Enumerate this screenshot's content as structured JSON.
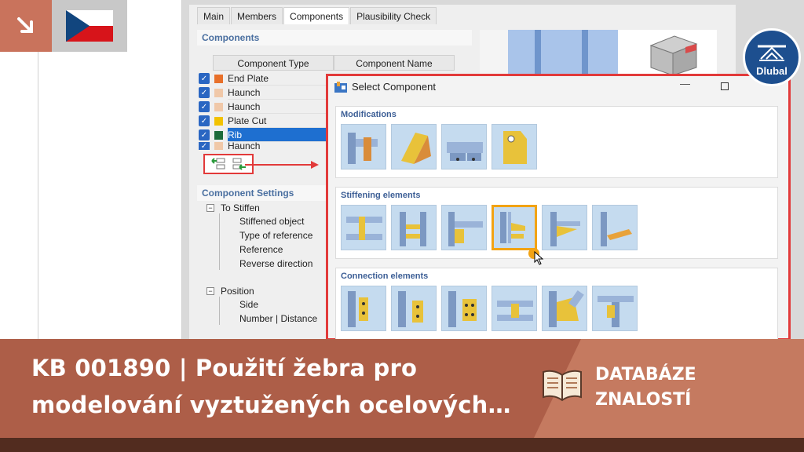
{
  "tabs": [
    "Main",
    "Members",
    "Components",
    "Plausibility Check"
  ],
  "components_section": {
    "title": "Components",
    "col_type": "Component Type",
    "col_name": "Component Name",
    "rows": [
      {
        "label": "End Plate",
        "color": "#e8702a"
      },
      {
        "label": "Haunch",
        "color": "#f0c8a8"
      },
      {
        "label": "Haunch",
        "color": "#f0c8a8"
      },
      {
        "label": "Plate Cut",
        "color": "#f2c200"
      },
      {
        "label": "Rib",
        "color": "#1e6b3a",
        "selected": true
      },
      {
        "label": "Haunch",
        "color": "#f0c8a8"
      }
    ]
  },
  "settings_section": {
    "title": "Component Settings",
    "group1": "To Stiffen",
    "group1_items": [
      "Stiffened object",
      "Type of reference",
      "Reference",
      "Reverse direction"
    ],
    "group2": "Position",
    "group2_items": [
      "Side",
      "Number | Distance"
    ]
  },
  "dialog": {
    "title": "Select Component",
    "groups": [
      {
        "title": "Modifications",
        "count": 4
      },
      {
        "title": "Stiffening elements",
        "count": 6,
        "selected_index": 3
      },
      {
        "title": "Connection elements",
        "count": 6
      }
    ]
  },
  "logo": {
    "name": "Dlubal"
  },
  "banner": {
    "line1": "KB 001890 | Použití žebra pro",
    "line2": "modelování vyztužených ocelových…",
    "label1": "DATABÁZE",
    "label2": "ZNALOSTÍ"
  },
  "colors": {
    "accent": "#e23a3a",
    "banner": "#ad5e48",
    "brand": "#1d4f8f"
  }
}
